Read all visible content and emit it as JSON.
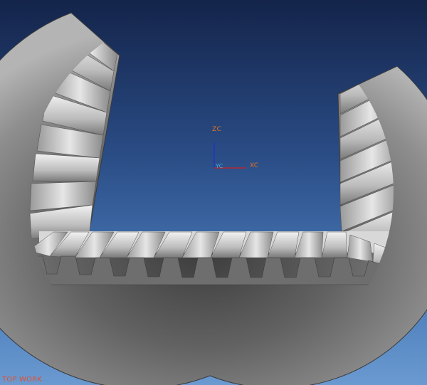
{
  "viewport": {
    "background_top": "#14244a",
    "background_bottom": "#6a9ad0",
    "view_mode": "TOP WORK"
  },
  "axes": {
    "z_label": "ZC",
    "x_label": "XC",
    "y_label": "YC",
    "z_color": "#2030c8",
    "x_color": "#d02020"
  },
  "model": {
    "description_icon": "bevel-gear-section-icon",
    "body_color": "#8a8a8a",
    "tooth_highlight": "#ececec"
  }
}
